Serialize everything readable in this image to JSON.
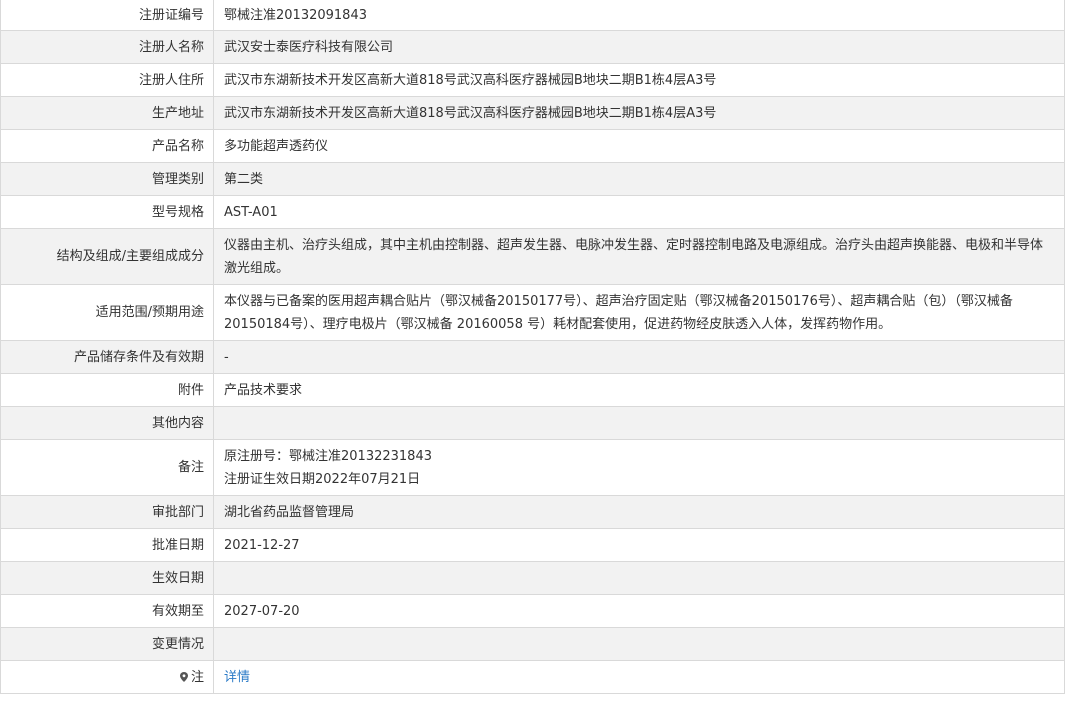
{
  "record": {
    "rows": [
      {
        "label": "注册证编号",
        "value": "鄂械注准20132091843"
      },
      {
        "label": "注册人名称",
        "value": "武汉安士泰医疗科技有限公司"
      },
      {
        "label": "注册人住所",
        "value": "武汉市东湖新技术开发区高新大道818号武汉高科医疗器械园B地块二期B1栋4层A3号"
      },
      {
        "label": "生产地址",
        "value": "武汉市东湖新技术开发区高新大道818号武汉高科医疗器械园B地块二期B1栋4层A3号"
      },
      {
        "label": "产品名称",
        "value": "多功能超声透药仪"
      },
      {
        "label": "管理类别",
        "value": "第二类"
      },
      {
        "label": "型号规格",
        "value": "AST-A01"
      },
      {
        "label": "结构及组成/主要组成成分",
        "value": "仪器由主机、治疗头组成，其中主机由控制器、超声发生器、电脉冲发生器、定时器控制电路及电源组成。治疗头由超声换能器、电极和半导体激光组成。"
      },
      {
        "label": "适用范围/预期用途",
        "value": "本仪器与已备案的医用超声耦合贴片（鄂汉械备20150177号）、超声治疗固定贴（鄂汉械备20150176号）、超声耦合贴（包）（鄂汉械备20150184号）、理疗电极片（鄂汉械备 20160058 号）耗材配套使用，促进药物经皮肤透入人体，发挥药物作用。"
      },
      {
        "label": "产品储存条件及有效期",
        "value": "-"
      },
      {
        "label": "附件",
        "value": "产品技术要求"
      },
      {
        "label": "其他内容",
        "value": ""
      },
      {
        "label": "备注",
        "value_line1": "原注册号：鄂械注准20132231843",
        "value_line2": "注册证生效日期2022年07月21日"
      },
      {
        "label": "审批部门",
        "value": "湖北省药品监督管理局"
      },
      {
        "label": "批准日期",
        "value": "2021-12-27"
      },
      {
        "label": "生效日期",
        "value": ""
      },
      {
        "label": "有效期至",
        "value": "2027-07-20"
      },
      {
        "label": "变更情况",
        "value": ""
      },
      {
        "label": "注",
        "icon": "map-pin-icon",
        "link": "详情"
      }
    ]
  },
  "colors": {
    "border": "#d9d9d9",
    "row_alt": "#f2f2f2",
    "text": "#333333",
    "link": "#2a7ac7"
  }
}
